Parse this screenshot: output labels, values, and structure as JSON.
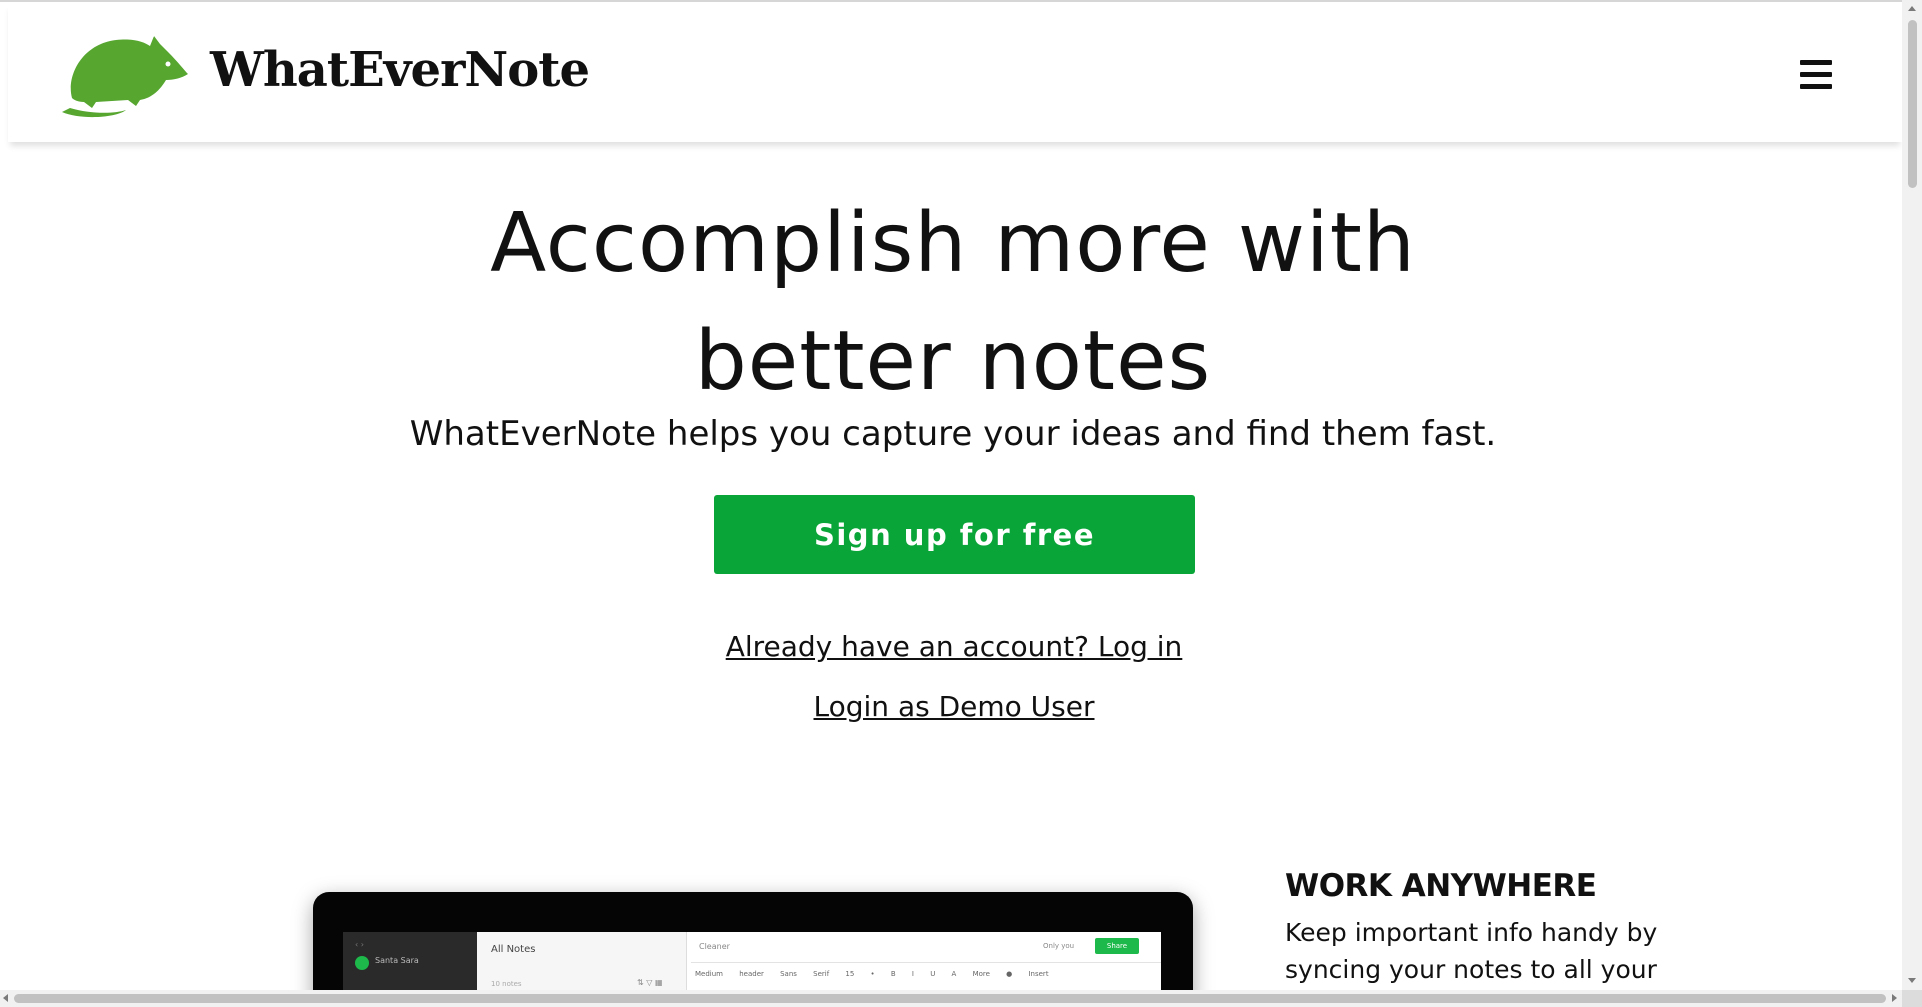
{
  "header": {
    "brand": "WhatEverNote",
    "logo_icon": "mouse-logo-icon",
    "menu_icon": "hamburger-menu-icon",
    "logo_color": "#56a630"
  },
  "hero": {
    "title_line1": "Accomplish more with",
    "title_line2": "better notes",
    "subtitle": "WhatEverNote helps you capture your ideas and find them fast.",
    "signup_label": "Sign up for free",
    "signup_color": "#0aa538",
    "login_link": "Already have an account? Log in",
    "demo_link": "Login as Demo User"
  },
  "preview": {
    "user": "Santa Sara",
    "list_title": "All Notes",
    "list_count": "10 notes",
    "editor_title": "Cleaner",
    "only_you": "Only you",
    "share": "Share",
    "toolbar": "Medium header  Sans Serif  15  •  B I U A  More  ● Insert"
  },
  "feature": {
    "title": "WORK ANYWHERE",
    "text": "Keep important info handy by syncing your notes to all your devices."
  }
}
